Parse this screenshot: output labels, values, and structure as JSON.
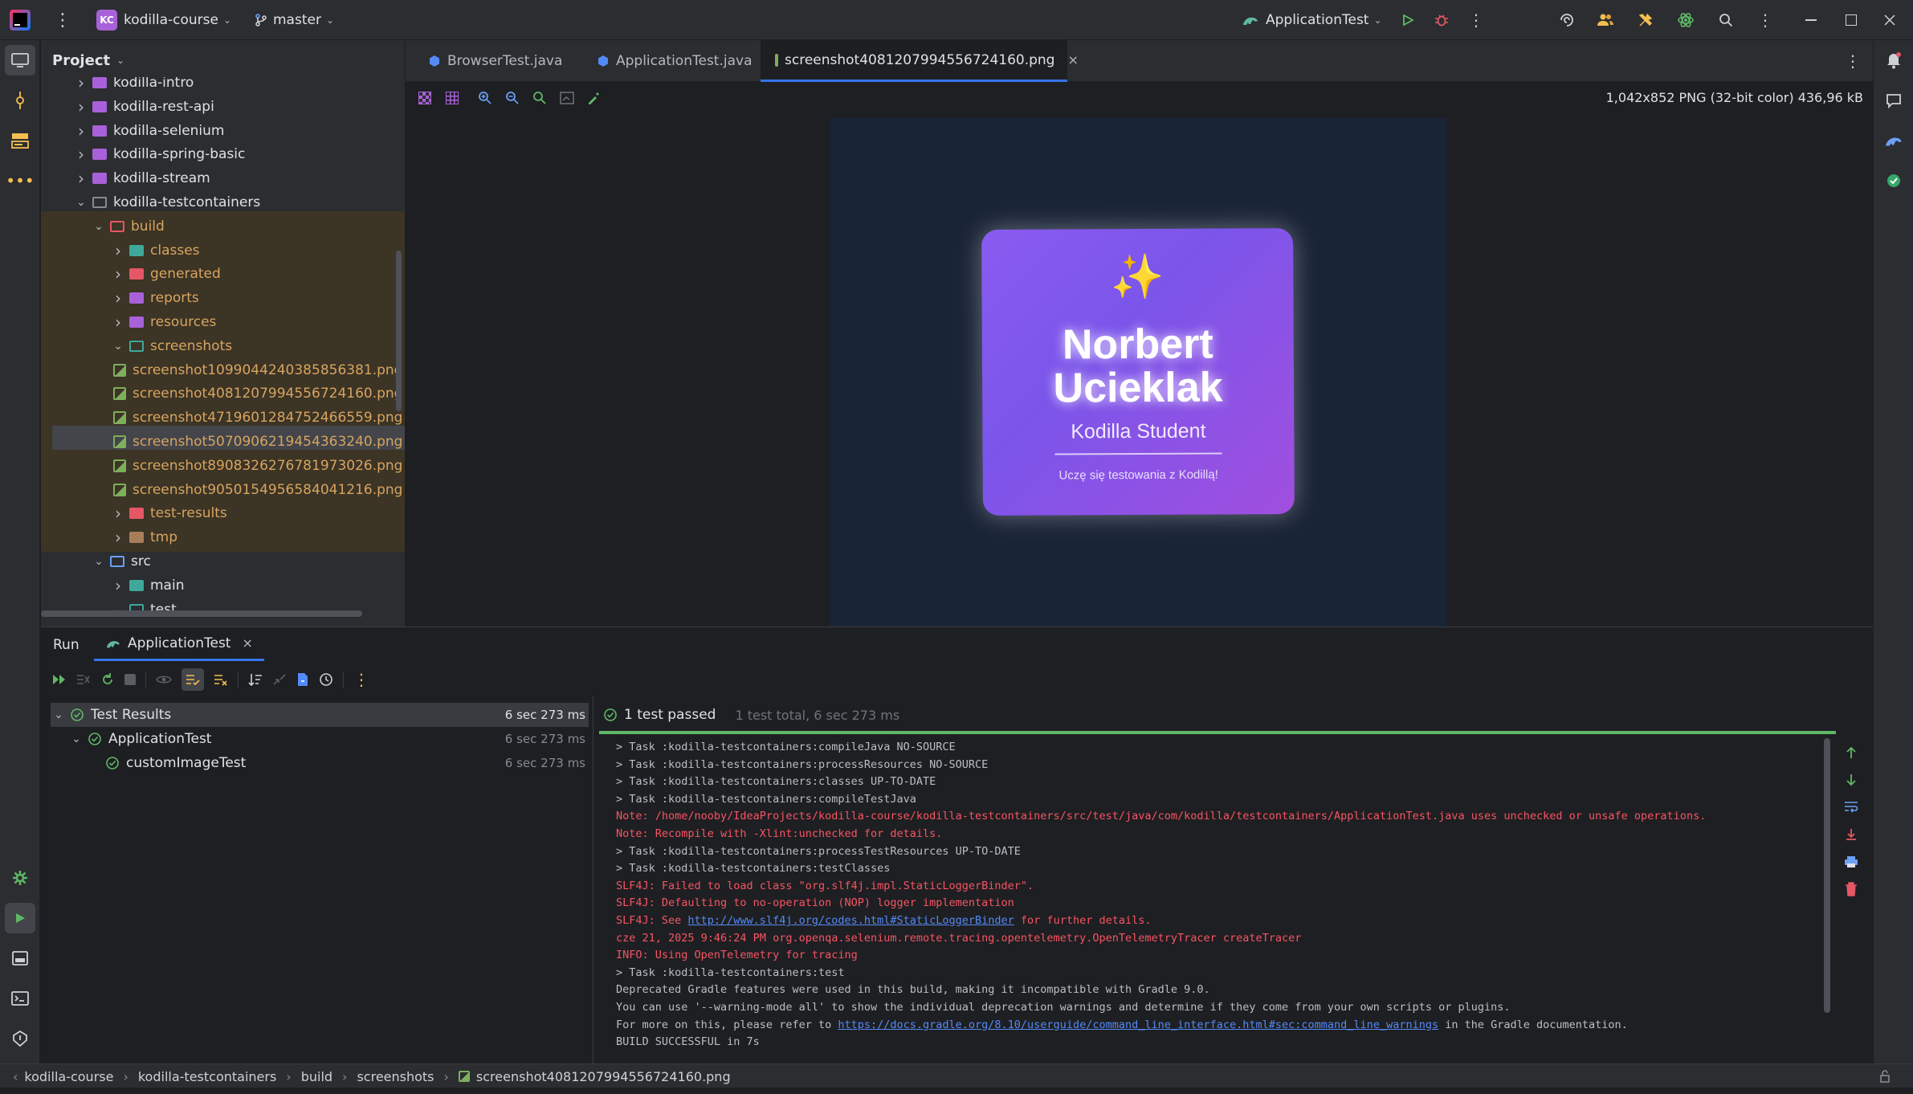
{
  "titlebar": {
    "project_badge": "KC",
    "project_name": "kodilla-course",
    "branch": "master",
    "run_config": "ApplicationTest"
  },
  "project_panel": {
    "title": "Project",
    "rows": [
      {
        "label": "kodilla-intro",
        "kind": "module"
      },
      {
        "label": "kodilla-rest-api",
        "kind": "module"
      },
      {
        "label": "kodilla-selenium",
        "kind": "module"
      },
      {
        "label": "kodilla-spring-basic",
        "kind": "module"
      },
      {
        "label": "kodilla-stream",
        "kind": "module"
      },
      {
        "label": "kodilla-testcontainers",
        "kind": "module"
      },
      {
        "label": "build",
        "kind": "folder"
      },
      {
        "label": "classes",
        "kind": "folder"
      },
      {
        "label": "generated",
        "kind": "folder"
      },
      {
        "label": "reports",
        "kind": "folder"
      },
      {
        "label": "resources",
        "kind": "folder"
      },
      {
        "label": "screenshots",
        "kind": "folder"
      },
      {
        "label": "screenshot1099044240385856381.png",
        "kind": "file"
      },
      {
        "label": "screenshot4081207994556724160.png",
        "kind": "file"
      },
      {
        "label": "screenshot4719601284752466559.png",
        "kind": "file"
      },
      {
        "label": "screenshot5070906219454363240.png",
        "kind": "file"
      },
      {
        "label": "screenshot8908326276781973026.png",
        "kind": "file"
      },
      {
        "label": "screenshot9050154956584041216.png",
        "kind": "file"
      },
      {
        "label": "test-results",
        "kind": "folder"
      },
      {
        "label": "tmp",
        "kind": "folder"
      },
      {
        "label": "src",
        "kind": "folder"
      },
      {
        "label": "main",
        "kind": "folder"
      },
      {
        "label": "test",
        "kind": "folder"
      }
    ]
  },
  "tabs": [
    {
      "label": "BrowserTest.java"
    },
    {
      "label": "ApplicationTest.java"
    },
    {
      "label": "screenshot4081207994556724160.png"
    }
  ],
  "image_viewer": {
    "info": "1,042x852 PNG (32-bit color) 436,96 kB",
    "card": {
      "emoji": "✨",
      "name_line1": "Norbert",
      "name_line2": "Ucieklak",
      "subtitle": "Kodilla Student",
      "caption": "Uczę się testowania z Kodillą!"
    }
  },
  "run_panel": {
    "title": "Run",
    "tab_label": "ApplicationTest",
    "tree": [
      {
        "label": "Test Results",
        "time": "6 sec 273 ms"
      },
      {
        "label": "ApplicationTest",
        "time": "6 sec 273 ms"
      },
      {
        "label": "customImageTest",
        "time": "6 sec 273 ms"
      }
    ],
    "status": "1 test passed",
    "status_detail": "1 test total, 6 sec 273 ms",
    "console": [
      {
        "text": "> Task :kodilla-testcontainers:compileJava NO-SOURCE",
        "type": "normal"
      },
      {
        "text": "> Task :kodilla-testcontainers:processResources NO-SOURCE",
        "type": "normal"
      },
      {
        "text": "> Task :kodilla-testcontainers:classes UP-TO-DATE",
        "type": "normal"
      },
      {
        "text": "> Task :kodilla-testcontainers:compileTestJava",
        "type": "normal"
      },
      {
        "text": "Note: /home/nooby/IdeaProjects/kodilla-course/kodilla-testcontainers/src/test/java/com/kodilla/testcontainers/ApplicationTest.java uses unchecked or unsafe operations.",
        "type": "err"
      },
      {
        "text": "Note: Recompile with -Xlint:unchecked for details.",
        "type": "err"
      },
      {
        "text": "> Task :kodilla-testcontainers:processTestResources UP-TO-DATE",
        "type": "normal"
      },
      {
        "text": "> Task :kodilla-testcontainers:testClasses",
        "type": "normal"
      },
      {
        "text": "SLF4J: Failed to load class \"org.slf4j.impl.StaticLoggerBinder\".",
        "type": "err"
      },
      {
        "text": "SLF4J: Defaulting to no-operation (NOP) logger implementation",
        "type": "err"
      },
      {
        "pre": "SLF4J: See ",
        "link": "http://www.slf4j.org/codes.html#StaticLoggerBinder",
        "post": " for further details.",
        "type": "err-link"
      },
      {
        "text": "cze 21, 2025 9:46:24 PM org.openqa.selenium.remote.tracing.opentelemetry.OpenTelemetryTracer createTracer",
        "type": "err"
      },
      {
        "text": "INFO: Using OpenTelemetry for tracing",
        "type": "err"
      },
      {
        "text": "> Task :kodilla-testcontainers:test",
        "type": "normal"
      },
      {
        "text": "Deprecated Gradle features were used in this build, making it incompatible with Gradle 9.0.",
        "type": "normal"
      },
      {
        "text": "You can use '--warning-mode all' to show the individual deprecation warnings and determine if they come from your own scripts or plugins.",
        "type": "normal"
      },
      {
        "pre": "For more on this, please refer to ",
        "link": "https://docs.gradle.org/8.10/userguide/command_line_interface.html#sec:command_line_warnings",
        "post": " in the Gradle documentation.",
        "type": "normal-link"
      },
      {
        "text": "BUILD SUCCESSFUL in 7s",
        "type": "normal"
      }
    ]
  },
  "statusbar": {
    "breadcrumbs": [
      "kodilla-course",
      "kodilla-testcontainers",
      "build",
      "screenshots",
      "screenshot4081207994556724160.png"
    ]
  }
}
